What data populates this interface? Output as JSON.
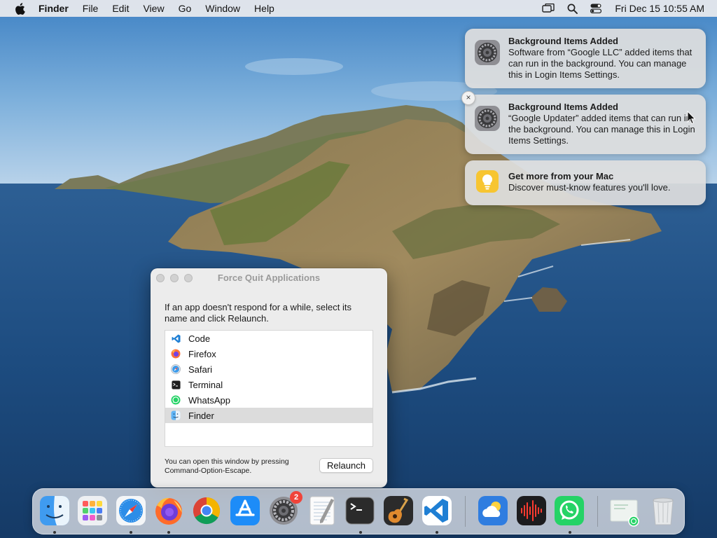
{
  "menubar": {
    "app_name": "Finder",
    "items": [
      "File",
      "Edit",
      "View",
      "Go",
      "Window",
      "Help"
    ],
    "clock": "Fri Dec 15  10:55 AM",
    "status_icons": [
      "screen-mirroring-icon",
      "spotlight-search-icon",
      "control-center-icon"
    ]
  },
  "notifications": [
    {
      "title": "Background Items Added",
      "body": "Software from “Google LLC” added items that can run in the background. You can manage this in Login Items Settings.",
      "icon": "system-settings-icon"
    },
    {
      "title": "Background Items Added",
      "body": "“Google Updater” added items that can run in the background. You can manage this in Login Items Settings.",
      "icon": "system-settings-icon"
    },
    {
      "title": "Get more from your Mac",
      "body": "Discover must-know features you'll love.",
      "icon": "tips-lightbulb-icon"
    }
  ],
  "notification_close_label": "×",
  "force_quit": {
    "title": "Force Quit Applications",
    "description": "If an app doesn't respond for a while, select its name and click Relaunch.",
    "apps": [
      {
        "name": "Code",
        "icon": "vscode-icon"
      },
      {
        "name": "Firefox",
        "icon": "firefox-icon"
      },
      {
        "name": "Safari",
        "icon": "safari-icon"
      },
      {
        "name": "Terminal",
        "icon": "terminal-icon"
      },
      {
        "name": "WhatsApp",
        "icon": "whatsapp-icon"
      },
      {
        "name": "Finder",
        "icon": "finder-icon"
      }
    ],
    "selected_app": "Finder",
    "hint": "You can open this window by pressing Command-Option-Escape.",
    "button_label": "Relaunch"
  },
  "dock": {
    "items": [
      {
        "name": "Finder",
        "icon": "finder-icon",
        "running": true
      },
      {
        "name": "Launchpad",
        "icon": "launchpad-icon",
        "running": false
      },
      {
        "name": "Safari",
        "icon": "safari-icon",
        "running": true
      },
      {
        "name": "Firefox",
        "icon": "firefox-icon",
        "running": true
      },
      {
        "name": "Google Chrome",
        "icon": "chrome-icon",
        "running": false
      },
      {
        "name": "App Store",
        "icon": "app-store-icon",
        "running": false
      },
      {
        "name": "System Settings",
        "icon": "system-settings-icon",
        "running": false,
        "badge": "2"
      },
      {
        "name": "TextEdit",
        "icon": "textedit-icon",
        "running": false
      },
      {
        "name": "Terminal",
        "icon": "terminal-icon",
        "running": true
      },
      {
        "name": "GarageBand",
        "icon": "garageband-icon",
        "running": false
      },
      {
        "name": "Visual Studio Code",
        "icon": "vscode-icon",
        "running": true
      },
      {
        "name": "Weather",
        "icon": "weather-icon",
        "running": false
      },
      {
        "name": "Voice Memos",
        "icon": "voice-memos-icon",
        "running": false
      },
      {
        "name": "WhatsApp",
        "icon": "whatsapp-icon",
        "running": true
      },
      {
        "name": "WhatsApp Download",
        "icon": "download-whatsapp-icon",
        "running": false
      },
      {
        "name": "Trash",
        "icon": "trash-icon",
        "running": false
      }
    ]
  }
}
